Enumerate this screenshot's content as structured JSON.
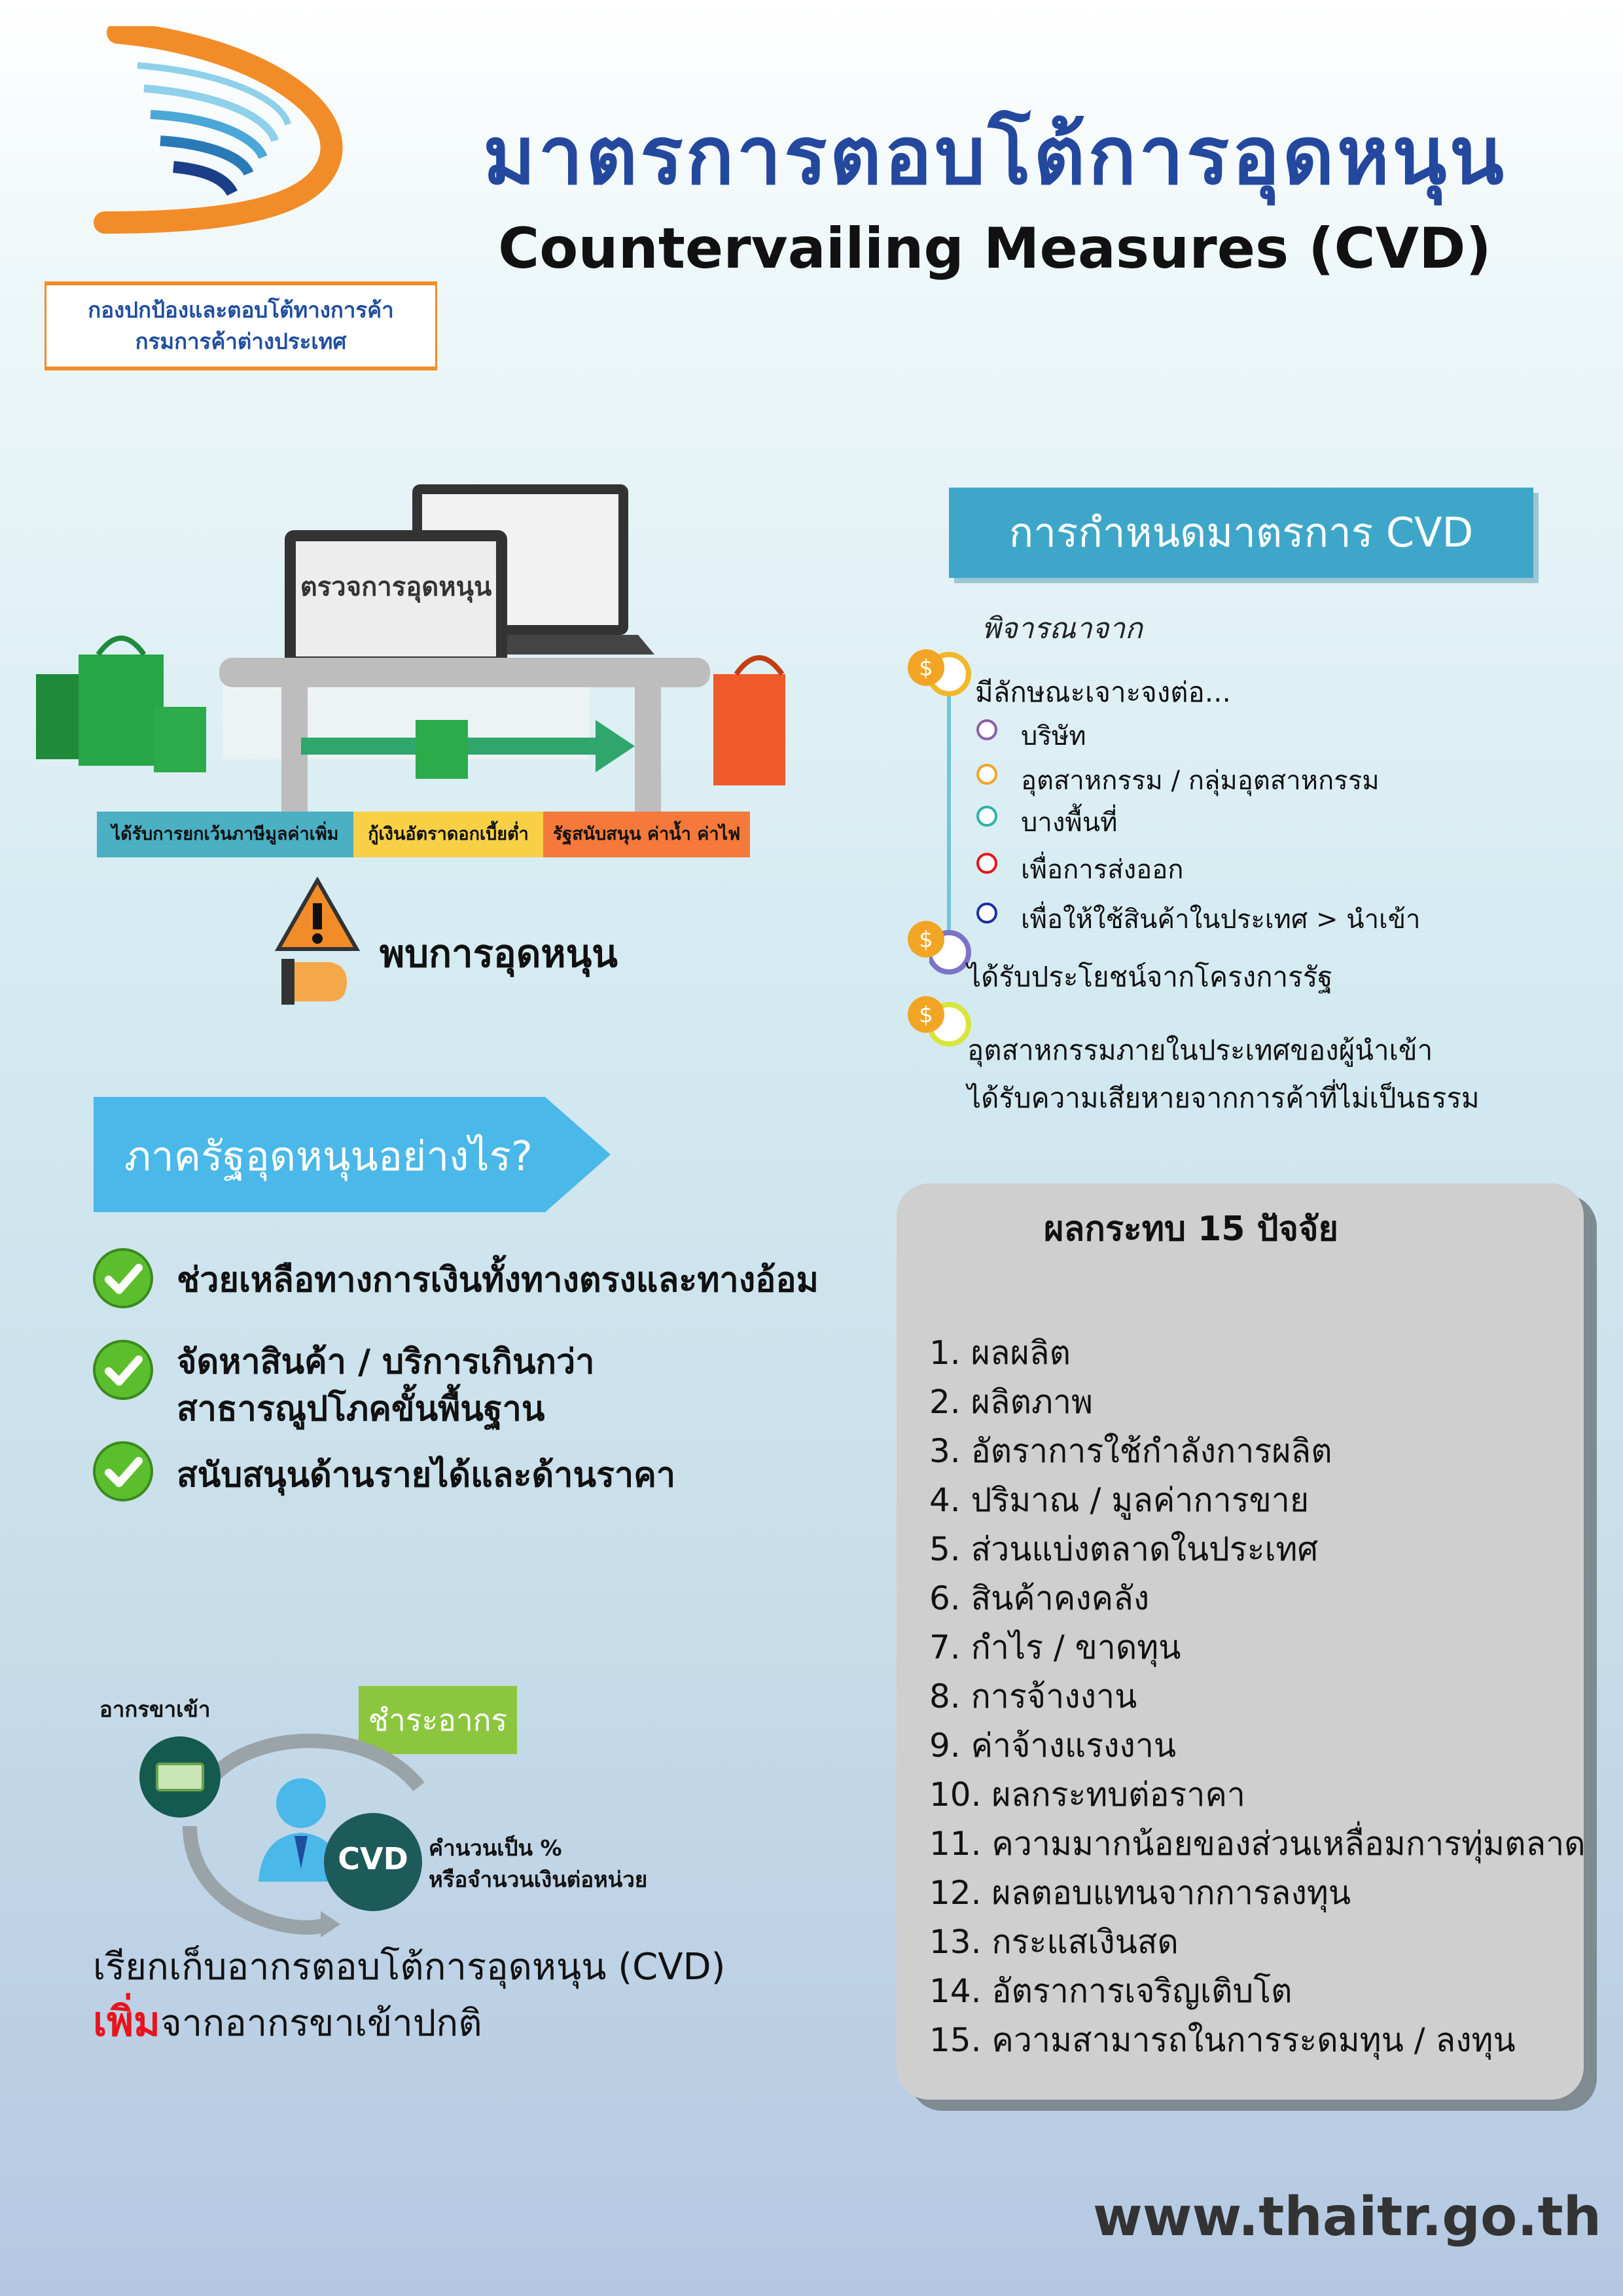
{
  "header": {
    "title_th": "มาตรการตอบโต้การอุดหนุน",
    "title_en": "Countervailing Measures (CVD)",
    "department": [
      "กองปกป้องและตอบโต้ทางการค้า",
      "กรมการค้าต่างประเทศ"
    ]
  },
  "illustration": {
    "screen_label": "ตรวจการอุดหนุน",
    "tags": [
      "ได้รับการยกเว้นภาษีมูลค่าเพิ่ม",
      "กู้เงินอัตราดอกเบี้ยต่ำ",
      "รัฐสนับสนุน ค่าน้ำ ค่าไฟ"
    ],
    "found": "พบการอุดหนุน"
  },
  "cvd": {
    "banner": "การกำหนดมาตรการ CVD",
    "consider": "พิจารณาจาก",
    "specific": "มีลักษณะเจาะจงต่อ...",
    "specific_items": [
      "บริษัท",
      "อุตสาหกรรม / กลุ่มอุตสาหกรรม",
      "บางพื้นที่",
      "เพื่อการส่งออก",
      "เพื่อให้ใช้สินค้าในประเทศ > นำเข้า"
    ],
    "benefit": "ได้รับประโยชน์จากโครงการรัฐ",
    "injury": [
      "อุตสาหกรรมภายในประเทศของผู้นำเข้า",
      "ได้รับความเสียหายจากการค้าที่ไม่เป็นธรรม"
    ]
  },
  "government": {
    "banner": "ภาครัฐอุดหนุนอย่างไร?",
    "bullets": [
      [
        "ช่วยเหลือทางการเงินทั้งทางตรงและทางอ้อม"
      ],
      [
        "จัดหาสินค้า / บริการเกินกว่า",
        "สาธารณูปโภคขั้นพื้นฐาน"
      ],
      [
        "สนับสนุนด้านรายได้และด้านราคา"
      ]
    ]
  },
  "duty": {
    "import_duty": "อากรขาเข้า",
    "pay": "ชำระอากร",
    "cvd_badge": "CVD",
    "calc": [
      "คำนวนเป็น %",
      "หรือจำนวนเงินต่อหน่วย"
    ],
    "collect": "เรียกเก็บอากรตอบโต้การอุดหนุน (CVD)",
    "more": "เพิ่ม",
    "more_rest": "จากอากรขาเข้าปกติ"
  },
  "impact": {
    "title": "ผลกระทบ 15 ปัจจัย",
    "items": [
      "1. ผลผลิต",
      "2. ผลิตภาพ",
      "3. อัตราการใช้กำลังการผลิต",
      "4. ปริมาณ / มูลค่าการขาย",
      "5. ส่วนแบ่งตลาดในประเทศ",
      "6. สินค้าคงคลัง",
      "7. กำไร / ขาดทุน",
      "8. การจ้างงาน",
      "9. ค่าจ้างแรงงาน",
      "10. ผลกระทบต่อราคา",
      "11. ความมากน้อยของส่วนเหลื่อมการทุ่มตลาด",
      "12. ผลตอบแทนจากการลงทุน",
      "13. กระแสเงินสด",
      "14. อัตราการเจริญเติบโต",
      "15. ความสามารถในการระดมทุน / ลงทุน"
    ]
  },
  "footer": {
    "website": "www.thaitr.go.th"
  },
  "colors": {
    "title_blue": "#23489d",
    "accent_orange": "#f28c28",
    "banner_blue": "#3ea7c9",
    "alert_red": "#e8141c",
    "check_green": "#5bbf2d"
  }
}
